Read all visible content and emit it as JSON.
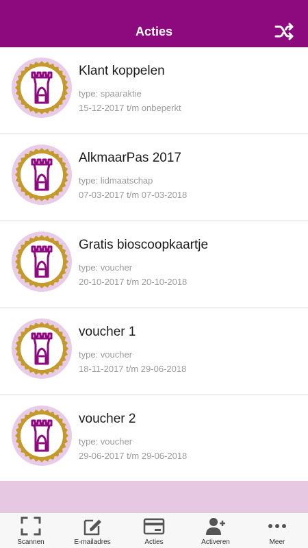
{
  "header": {
    "title": "Acties",
    "right_icon": "shuffle-icon"
  },
  "colors": {
    "primary": "#8c0a7e",
    "filler": "#e6c8e3",
    "badge_outer": "#e8cbe6",
    "badge_gold": "#c39a2b"
  },
  "actions": [
    {
      "title": "Klant koppelen",
      "type": "type: spaaraktie",
      "dates": "15-12-2017 t/m onbeperkt"
    },
    {
      "title": "AlkmaarPas 2017",
      "type": "type: lidmaatschap",
      "dates": "07-03-2017 t/m 07-03-2018"
    },
    {
      "title": "Gratis bioscoopkaartje",
      "type": "type: voucher",
      "dates": "20-10-2017 t/m 20-10-2018"
    },
    {
      "title": "voucher 1",
      "type": "type: voucher",
      "dates": "18-11-2017 t/m 29-06-2018"
    },
    {
      "title": "voucher 2",
      "type": "type: voucher",
      "dates": "29-06-2017 t/m 29-06-2018"
    }
  ],
  "tabbar": {
    "tabs": [
      {
        "label": "Scannen",
        "icon": "scan-icon"
      },
      {
        "label": "E-mailadres",
        "icon": "edit-icon"
      },
      {
        "label": "Acties",
        "icon": "card-icon"
      },
      {
        "label": "Activeren",
        "icon": "add-user-icon"
      },
      {
        "label": "Meer",
        "icon": "more-icon"
      }
    ]
  }
}
